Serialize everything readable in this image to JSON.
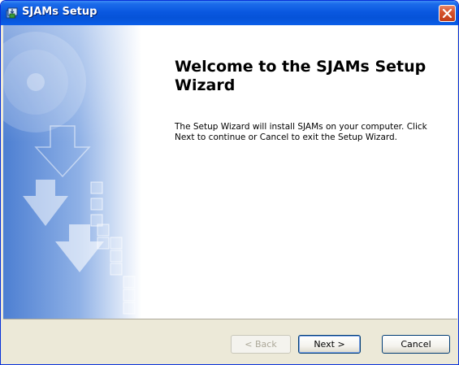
{
  "window": {
    "title": "SJAMs Setup",
    "icon": "installer-icon",
    "close_icon": "close-icon"
  },
  "main": {
    "heading": "Welcome to the SJAMs Setup Wizard",
    "description": "The Setup Wizard will install SJAMs on your computer.  Click Next to continue or Cancel to exit the Setup Wizard."
  },
  "footer": {
    "back_label": "< Back",
    "next_label": "Next >",
    "cancel_label": "Cancel"
  },
  "colors": {
    "titlebar": "#0a58e0",
    "banner_blue": "#5b8bd8",
    "face": "#ece9d8",
    "close": "#d6532e"
  }
}
